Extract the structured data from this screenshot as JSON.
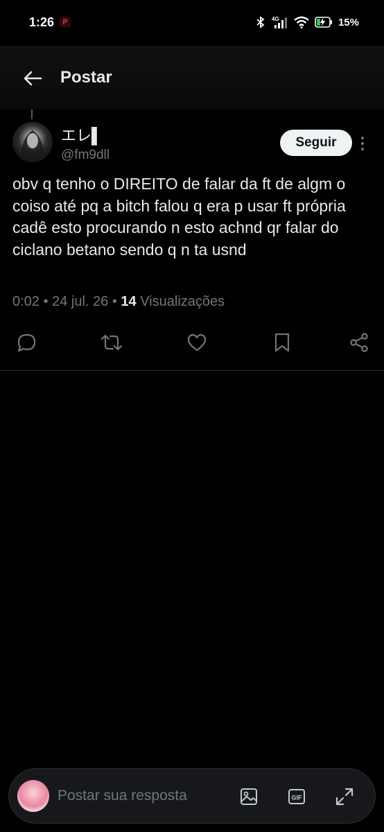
{
  "status_bar": {
    "time": "1:26",
    "notification_icon": "pinterest-icon",
    "network": "4G",
    "battery_percent": "15%"
  },
  "header": {
    "title": "Postar",
    "back_icon": "arrow-left-icon"
  },
  "post": {
    "author": {
      "display_name": "エレ▌",
      "handle": "@fm9dll"
    },
    "follow_label": "Seguir",
    "text": "obv q tenho o DIREITO de falar da ft de algm o coiso até pq a bitch falou q era p usar ft própria cadê esto procurando n esto achnd qr falar do ciclano betano sendo q n ta usnd",
    "time": "0:02",
    "date": "24 jul. 26",
    "views_count": "14",
    "views_label": "Visualizações",
    "separator": "•"
  },
  "actions": [
    "reply-icon",
    "repost-icon",
    "like-icon",
    "bookmark-icon",
    "share-icon"
  ],
  "reply_bar": {
    "placeholder": "Postar sua resposta",
    "icons": [
      "image-icon",
      "gif-icon",
      "expand-icon"
    ]
  },
  "colors": {
    "background": "#000000",
    "text": "#e7e9ea",
    "muted": "#71767b",
    "follow_bg": "#eff3f4"
  }
}
